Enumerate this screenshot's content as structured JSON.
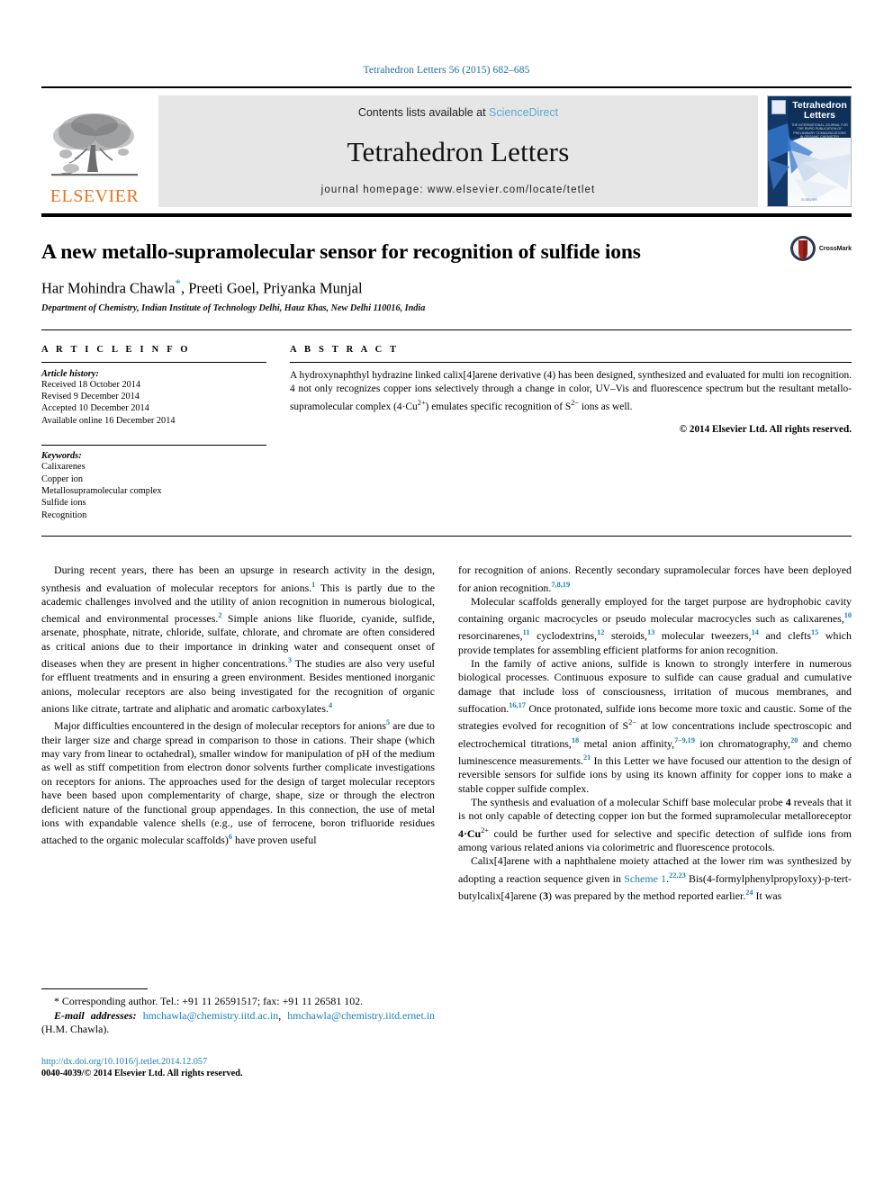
{
  "running_head": "Tetrahedron Letters 56 (2015) 682–685",
  "masthead": {
    "publisher_name": "ELSEVIER",
    "contents_prefix": "Contents lists available at ",
    "contents_link": "ScienceDirect",
    "journal_title": "Tetrahedron Letters",
    "homepage": "journal homepage: www.elsevier.com/locate/tetlet",
    "cover": {
      "title_line1": "Tetrahedron",
      "title_line2": "Letters",
      "subtitle": "THE INTERNATIONAL JOURNAL FOR THE RAPID PUBLICATION OF PRELIMINARY COMMUNICATIONS IN ORGANIC CHEMISTRY",
      "footer": "ELSEVIER"
    }
  },
  "article": {
    "title": "A new metallo-supramolecular sensor for recognition of sulfide ions",
    "crossmark_label": "CrossMark",
    "authors_pre": "Har Mohindra Chawla",
    "authors_star": "*",
    "authors_post": ", Preeti Goel, Priyanka Munjal",
    "affiliation": "Department of Chemistry, Indian Institute of Technology Delhi, Hauz Khas, New Delhi 110016, India"
  },
  "info": {
    "heading": "A R T I C L E    I N F O",
    "history_label": "Article history:",
    "history": [
      "Received 18 October 2014",
      "Revised 9 December 2014",
      "Accepted 10 December 2014",
      "Available online 16 December 2014"
    ],
    "keywords_label": "Keywords:",
    "keywords": [
      "Calixarenes",
      "Copper ion",
      "Metallosupramolecular complex",
      "Sulfide ions",
      "Recognition"
    ]
  },
  "abstract": {
    "heading": "A B S T R A C T",
    "body_1": "A hydroxynaphthyl hydrazine linked calix[4]arene derivative (4) has been designed, synthesized and evaluated for multi ion recognition. 4 not only recognizes copper ions selectively through a change in color, UV–Vis and fluorescence spectrum but the resultant metallo-supramolecular complex (4·Cu",
    "sup_cu": "2+",
    "body_2": ") emulates specific recognition of S",
    "sup_s": "2−",
    "body_3": " ions as well.",
    "copyright": "© 2014 Elsevier Ltd. All rights reserved."
  },
  "body": {
    "left": {
      "p1_a": "During recent years, there has been an upsurge in research activity in the design, synthesis and evaluation of molecular receptors for anions.",
      "p1_r1": "1",
      "p1_b": " This is partly due to the academic challenges involved and the utility of anion recognition in numerous biological, chemical and environmental processes.",
      "p1_r2": "2",
      "p1_c": " Simple anions like fluoride, cyanide, sulfide, arsenate, phosphate, nitrate, chloride, sulfate, chlorate, and chromate are often considered as critical anions due to their importance in drinking water and consequent onset of diseases when they are present in higher concentrations.",
      "p1_r3": "3",
      "p1_d": " The studies are also very useful for effluent treatments and in ensuring a green environment. Besides mentioned inorganic anions, molecular receptors are also being investigated for the recognition of organic anions like citrate, tartrate and aliphatic and aromatic carboxylates.",
      "p1_r4": "4",
      "p2_a": "Major difficulties encountered in the design of molecular receptors for anions",
      "p2_r1": "5",
      "p2_b": " are due to their larger size and charge spread in comparison to those in cations. Their shape (which may vary from linear to octahedral), smaller window for manipulation of pH of the medium as well as stiff competition from electron donor solvents further complicate investigations on receptors for anions. The approaches used for the design of target molecular receptors have been based upon complementarity of charge, shape, size or through the electron deficient nature of the functional group appendages. In this connection, the use of metal ions with expandable valence shells (e.g., use of ferrocene, boron trifluoride residues attached to the organic molecular scaffolds)",
      "p2_r2": "6",
      "p2_c": " have proven useful"
    },
    "right": {
      "p1_a": "for recognition of anions. Recently secondary supramolecular forces have been deployed for anion recognition.",
      "p1_r1": "7,8,19",
      "p2_a": "Molecular scaffolds generally employed for the target purpose are hydrophobic cavity containing organic macrocycles or pseudo molecular macrocycles such as calixarenes,",
      "p2_r1": "10",
      "p2_b": " resorcinarenes,",
      "p2_r2": "11",
      "p2_c": " cyclodextrins,",
      "p2_r3": "12",
      "p2_d": " steroids,",
      "p2_r4": "13",
      "p2_e": " molecular tweezers,",
      "p2_r5": "14",
      "p2_f": " and clefts",
      "p2_r6": "15",
      "p2_g": " which provide templates for assembling efficient platforms for anion recognition.",
      "p3_a": "In the family of active anions, sulfide is known to strongly interfere in numerous biological processes. Continuous exposure to sulfide can cause gradual and cumulative damage that include loss of consciousness, irritation of mucous membranes, and suffocation.",
      "p3_r1": "16,17",
      "p3_b": " Once protonated, sulfide ions become more toxic and caustic. Some of the strategies evolved for recognition of S",
      "p3_sup": "2−",
      "p3_c": " at low concentrations include spectroscopic and electrochemical titrations,",
      "p3_r2": "18",
      "p3_d": " metal anion affinity,",
      "p3_r3": "7–9,19",
      "p3_e": " ion chromatography,",
      "p3_r4": "20",
      "p3_f": " and chemo luminescence measurements.",
      "p3_r5": "21",
      "p3_g": " In this Letter we have focused our attention to the design of reversible sensors for sulfide ions by using its known affinity for copper ions to make a stable copper sulfide complex.",
      "p4_a": "The synthesis and evaluation of a molecular Schiff base molecular probe ",
      "p4_b1": "4",
      "p4_b": " reveals that it is not only capable of detecting copper ion but the formed supramolecular metalloreceptor ",
      "p4_b2": "4·Cu",
      "p4_sup": "2+",
      "p4_c": " could be further used for selective and specific detection of sulfide ions from among various related anions via colorimetric and fluorescence protocols.",
      "p5_a": "Calix[4]arene with a naphthalene moiety attached at the lower rim was synthesized by adopting a reaction sequence given in ",
      "p5_link": "Scheme 1",
      "p5_b": ".",
      "p5_r1": "22,23",
      "p5_c": " Bis(4-formylphenylpropyloxy)-p-tert-butylcalix[4]arene (",
      "p5_b1": "3",
      "p5_d": ") was prepared by the method reported earlier.",
      "p5_r2": "24",
      "p5_e": " It was"
    }
  },
  "footnotes": {
    "corresponding": "* Corresponding author. Tel.: +91 11 26591517; fax: +91 11 26581 102.",
    "email_label": "E-mail addresses:",
    "email_1": "hmchawla@chemistry.iitd.ac.in",
    "email_sep": ", ",
    "email_2": "hmchawla@chemistry.iitd.ernet.in",
    "email_tail": " (H.M. Chawla).",
    "doi": "http://dx.doi.org/10.1016/j.tetlet.2014.12.057",
    "issn": "0040-4039/© 2014 Elsevier Ltd. All rights reserved."
  }
}
